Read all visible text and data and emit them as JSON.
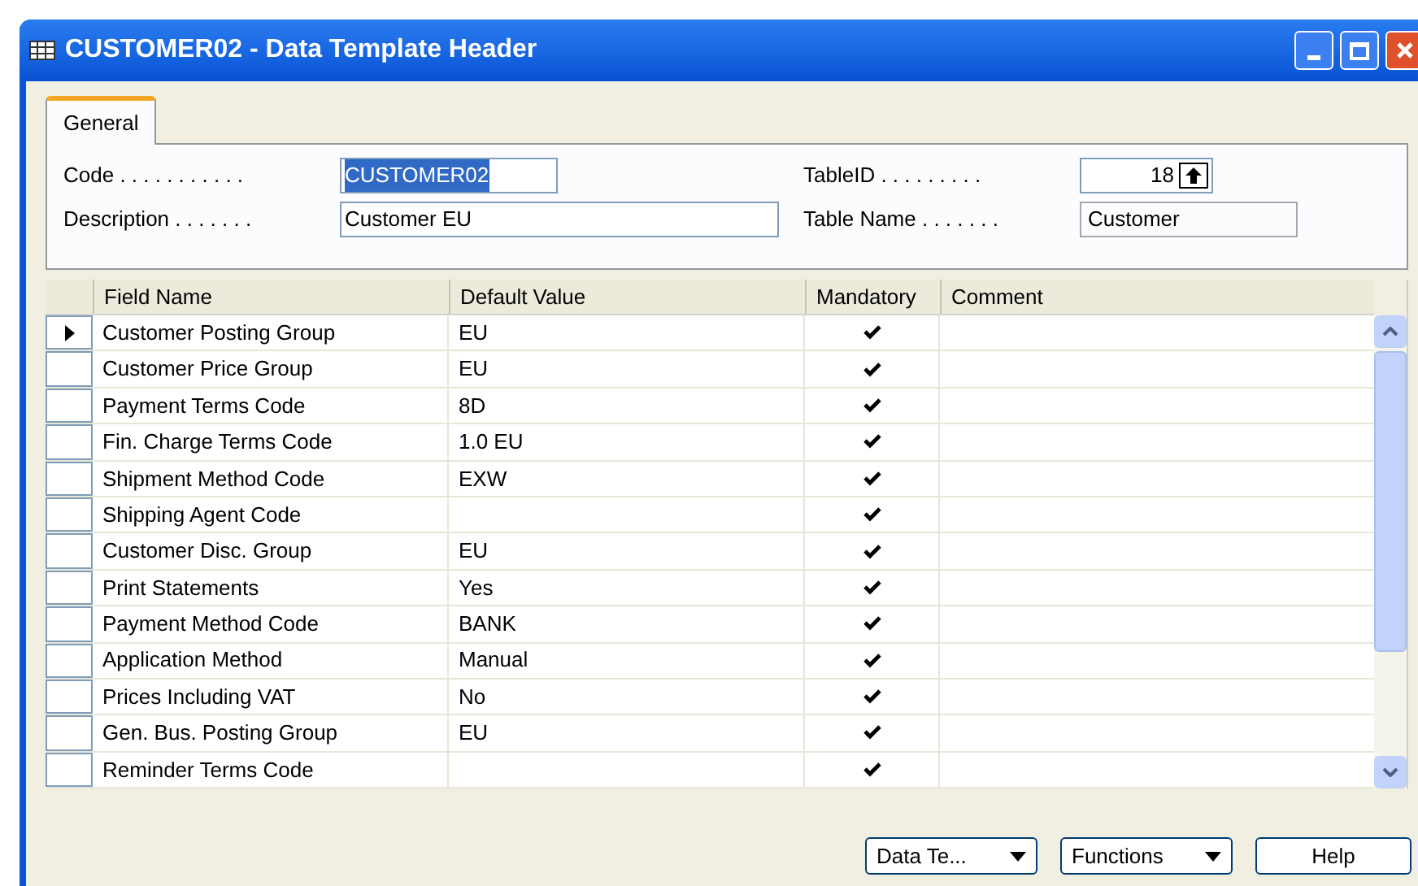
{
  "window": {
    "title": "CUSTOMER02 - Data Template Header"
  },
  "tabs": [
    {
      "label": "General",
      "selected": true
    }
  ],
  "fields_left": [
    {
      "label": "Code . . . . . . . . . . .",
      "value": "CUSTOMER02",
      "highlighted": true
    },
    {
      "label": "Description . . . . . . .",
      "value": "Customer EU",
      "highlighted": false
    }
  ],
  "fields_right": [
    {
      "label": "TableID . . . . . . . . .",
      "value": "18",
      "kind": "lookup"
    },
    {
      "label": "Table Name . . . . . . .",
      "value": "Customer",
      "kind": "readonly"
    }
  ],
  "table": {
    "columns": [
      "Field Name",
      "Default Value",
      "Mandatory",
      "Comment"
    ],
    "rows": [
      {
        "field_name": "Customer Posting Group",
        "default_value": "EU",
        "mandatory": true,
        "selected": true
      },
      {
        "field_name": "Customer Price Group",
        "default_value": "EU",
        "mandatory": true,
        "selected": false
      },
      {
        "field_name": "Payment Terms Code",
        "default_value": "8D",
        "mandatory": true,
        "selected": false
      },
      {
        "field_name": "Fin. Charge Terms Code",
        "default_value": "1.0 EU",
        "mandatory": true,
        "selected": false
      },
      {
        "field_name": "Shipment Method Code",
        "default_value": "EXW",
        "mandatory": true,
        "selected": false
      },
      {
        "field_name": "Shipping Agent Code",
        "default_value": "",
        "mandatory": true,
        "selected": false
      },
      {
        "field_name": "Customer Disc. Group",
        "default_value": "EU",
        "mandatory": true,
        "selected": false
      },
      {
        "field_name": "Print Statements",
        "default_value": "Yes",
        "mandatory": true,
        "selected": false
      },
      {
        "field_name": "Payment Method Code",
        "default_value": "BANK",
        "mandatory": true,
        "selected": false
      },
      {
        "field_name": "Application Method",
        "default_value": "Manual",
        "mandatory": true,
        "selected": false
      },
      {
        "field_name": "Prices Including VAT",
        "default_value": "No",
        "mandatory": true,
        "selected": false
      },
      {
        "field_name": "Gen. Bus. Posting Group",
        "default_value": "EU",
        "mandatory": true,
        "selected": false
      },
      {
        "field_name": "Reminder Terms Code",
        "default_value": "",
        "mandatory": true,
        "selected": false
      }
    ]
  },
  "buttons": [
    {
      "label": "Data Te...",
      "kind": "menu"
    },
    {
      "label": "Functions",
      "kind": "menu"
    },
    {
      "label": "Help",
      "kind": "plain"
    }
  ]
}
